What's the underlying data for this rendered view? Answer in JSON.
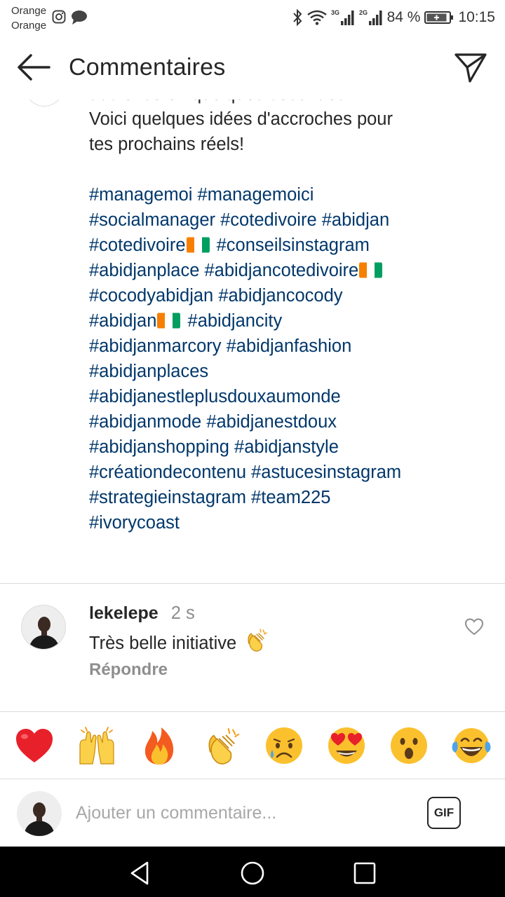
{
  "status_bar": {
    "carrier_line1": "Orange",
    "carrier_line2": "Orange",
    "network_1": "3G",
    "network_2": "2G",
    "battery": "84 %",
    "time": "10:15",
    "icons": [
      "instagram-icon",
      "message-icon",
      "bluetooth-icon",
      "wifi-icon",
      "signal-icon",
      "battery-icon"
    ]
  },
  "header": {
    "title": "Commentaires",
    "back_icon": "back-arrow-icon",
    "send_icon": "send-icon"
  },
  "caption": {
    "lines": [
      "audience en quelques secondes !",
      "Voici quelques idées d'accroches pour",
      "tes prochains réels!"
    ],
    "hashtag_lines": [
      [
        "#managemoi",
        "#managemoici"
      ],
      [
        "#socialmanager",
        "#cotedivoire",
        "#abidjan"
      ],
      [
        "#cotedivoire",
        "🇨🇮",
        "#conseilsinstagram"
      ],
      [
        "#abidjanplace",
        "#abidjancotedivoire",
        "🇨🇮"
      ],
      [
        "#cocodyabidjan",
        "#abidjancocody"
      ],
      [
        "#abidjan",
        "🇨🇮",
        "#abidjancity"
      ],
      [
        "#abidjanmarcory",
        "#abidjanfashion"
      ],
      [
        "#abidjanplaces"
      ],
      [
        "#abidjanestleplusdouxaumonde"
      ],
      [
        "#abidjanmode",
        "#abidjanestdoux"
      ],
      [
        "#abidjanshopping",
        "#abidjanstyle"
      ],
      [
        "#créationdecontenu",
        "#astucesinstagram"
      ],
      [
        "#strategieinstagram",
        "#team225"
      ],
      [
        "#ivorycoast"
      ]
    ],
    "hashtag_color": "#00376b"
  },
  "comment": {
    "username": "lekelepe",
    "time": "2 s",
    "text": "Très belle initiative",
    "emoji": "👏",
    "reply_label": "Répondre"
  },
  "emoji_bar": [
    {
      "name": "red-heart-emoji",
      "glyph": "❤️"
    },
    {
      "name": "raising-hands-emoji",
      "glyph": "🙌"
    },
    {
      "name": "fire-emoji",
      "glyph": "🔥"
    },
    {
      "name": "clapping-hands-emoji",
      "glyph": "👏"
    },
    {
      "name": "sad-face-emoji",
      "glyph": "😢"
    },
    {
      "name": "heart-eyes-emoji",
      "glyph": "😍"
    },
    {
      "name": "surprised-face-emoji",
      "glyph": "😮"
    },
    {
      "name": "tears-of-joy-emoji",
      "glyph": "😂"
    }
  ],
  "composer": {
    "placeholder": "Ajouter un commentaire...",
    "gif_label": "GIF"
  },
  "nav": [
    "back-triangle-icon",
    "home-circle-icon",
    "recents-square-icon"
  ]
}
